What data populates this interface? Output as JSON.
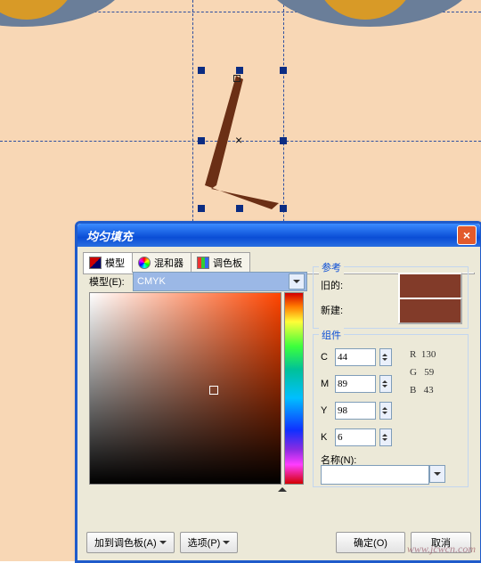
{
  "dialog": {
    "title": "均匀填充",
    "close": "×",
    "tabs": {
      "model": "模型",
      "mixer": "混和器",
      "palette": "调色板"
    },
    "model_label": "模型(E):",
    "model_value": "CMYK",
    "ref": {
      "legend": "参考",
      "old": "旧的:",
      "new": "新建:",
      "color": "#823b29"
    },
    "comp": {
      "legend": "组件",
      "c_label": "C",
      "c": "44",
      "m_label": "M",
      "m": "89",
      "y_label": "Y",
      "y": "98",
      "k_label": "K",
      "k": "6",
      "r_label": "R",
      "r": "130",
      "g_label": "G",
      "g": "59",
      "b_label": "B",
      "b": "43",
      "name_label": "名称(N):"
    },
    "buttons": {
      "addpal": "加到调色板(A)",
      "options": "选项(P)",
      "ok": "确定(O)",
      "cancel": "取消"
    }
  },
  "watermark": "www.jcwcn.com"
}
